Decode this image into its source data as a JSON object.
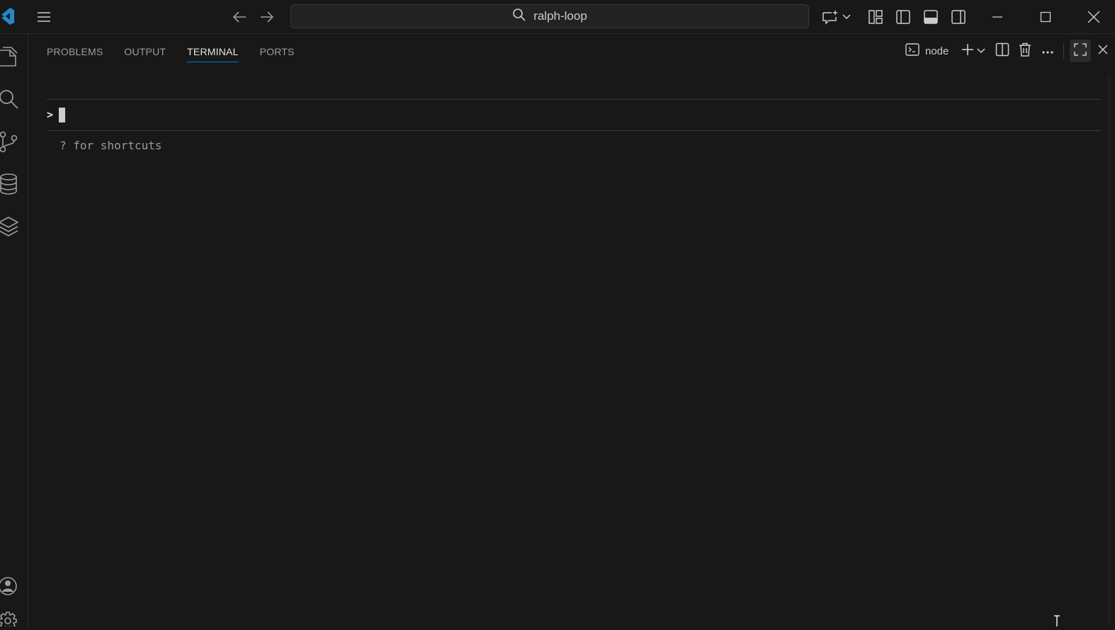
{
  "titlebar": {
    "search_text": "ralph-loop",
    "icons": [
      "vscode-logo-icon",
      "menu-icon",
      "back-arrow-icon",
      "forward-arrow-icon",
      "search-icon",
      "chat-sparkle-icon",
      "chevron-down-icon",
      "customize-layout-icon",
      "toggle-primary-sidebar-icon",
      "toggle-panel-icon",
      "toggle-secondary-sidebar-icon",
      "minimize-icon",
      "maximize-icon",
      "close-icon"
    ]
  },
  "activitybar": {
    "items": [
      "explorer-icon",
      "search-icon",
      "source-control-icon",
      "database-icon",
      "layers-icon",
      "accounts-icon",
      "settings-gear-icon"
    ]
  },
  "panel": {
    "tabs": [
      {
        "label": "PROBLEMS",
        "active": false
      },
      {
        "label": "OUTPUT",
        "active": false
      },
      {
        "label": "TERMINAL",
        "active": true
      },
      {
        "label": "PORTS",
        "active": false
      }
    ],
    "terminal_name": "node"
  },
  "terminal": {
    "prompt": ">",
    "hint": "? for shortcuts"
  },
  "colors": {
    "background": "#181818",
    "accent": "#0078d4",
    "logo": "#2489ca"
  }
}
